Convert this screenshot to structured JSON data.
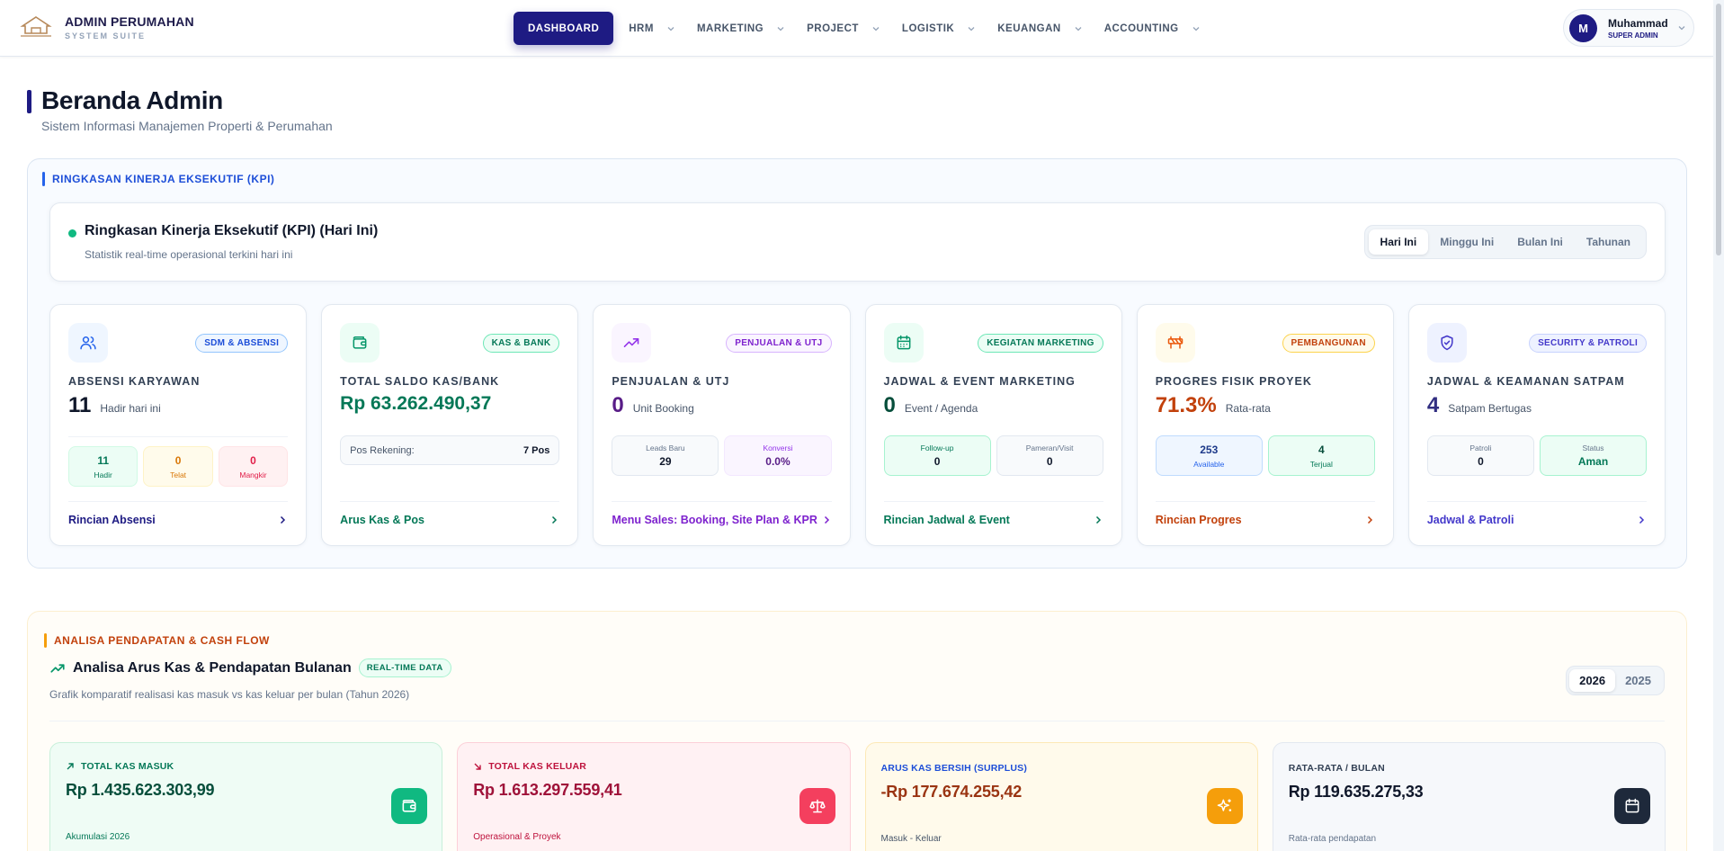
{
  "brand": {
    "title": "ADMIN PERUMAHAN",
    "subtitle": "SYSTEM SUITE"
  },
  "nav": {
    "dashboard": "DASHBOARD",
    "hrm": "HRM",
    "marketing": "MARKETING",
    "project": "PROJECT",
    "logistik": "LOGISTIK",
    "keuangan": "KEUANGAN",
    "accounting": "ACCOUNTING"
  },
  "user": {
    "initial": "M",
    "name": "Muhammad",
    "role": "SUPER ADMIN"
  },
  "page": {
    "title": "Beranda Admin",
    "subtitle": "Sistem Informasi Manajemen Properti & Perumahan"
  },
  "kpi": {
    "section_label": "RINGKASAN KINERJA EKSEKUTIF (KPI)",
    "header_title": "Ringkasan Kinerja Eksekutif (KPI) (Hari Ini)",
    "header_sub": "Statistik real-time operasional terkini hari ini",
    "periods": [
      "Hari Ini",
      "Minggu Ini",
      "Bulan Ini",
      "Tahunan"
    ],
    "active_period": "Hari Ini",
    "cards": {
      "absensi": {
        "badge": "SDM & ABSENSI",
        "title": "ABSENSI KARYAWAN",
        "value": "11",
        "unit": "Hadir hari ini",
        "hadir": "11",
        "hadir_label": "Hadir",
        "telat": "0",
        "telat_label": "Telat",
        "mangkir": "0",
        "mangkir_label": "Mangkir",
        "link": "Rincian Absensi"
      },
      "kas": {
        "badge": "KAS & BANK",
        "title": "TOTAL SALDO KAS/BANK",
        "value": "Rp 63.262.490,37",
        "pos_label": "Pos Rekening:",
        "pos_value": "7 Pos",
        "link": "Arus Kas & Pos"
      },
      "penjualan": {
        "badge": "PENJUALAN & UTJ",
        "title": "PENJUALAN & UTJ",
        "value": "0",
        "unit": "Unit Booking",
        "leads_label": "Leads Baru",
        "leads": "29",
        "konversi_label": "Konversi",
        "konversi": "0.0%",
        "link": "Menu Sales: Booking, Site Plan & KPR"
      },
      "marketing": {
        "badge": "KEGIATAN MARKETING",
        "title": "JADWAL & EVENT MARKETING",
        "value": "0",
        "unit": "Event / Agenda",
        "followup_label": "Follow-up",
        "followup": "0",
        "pameran_label": "Pameran/Visit",
        "pameran": "0",
        "link": "Rincian Jadwal & Event"
      },
      "progres": {
        "badge": "PEMBANGUNAN",
        "title": "PROGRES FISIK PROYEK",
        "value": "71.3%",
        "unit": "Rata-rata",
        "available": "253",
        "available_label": "Available",
        "terjual": "4",
        "terjual_label": "Terjual",
        "link": "Rincian Progres"
      },
      "security": {
        "badge": "SECURITY & PATROLI",
        "title": "JADWAL & KEAMANAN SATPAM",
        "value": "4",
        "unit": "Satpam Bertugas",
        "patroli_label": "Patroli",
        "patroli": "0",
        "status_label": "Status",
        "status": "Aman",
        "link": "Jadwal & Patroli"
      }
    }
  },
  "cashflow": {
    "section_label": "ANALISA PENDAPATAN & CASH FLOW",
    "title": "Analisa Arus Kas & Pendapatan Bulanan",
    "pill": "REAL-TIME DATA",
    "subtitle": "Grafik komparatif realisasi kas masuk vs kas keluar per bulan (Tahun 2026)",
    "years": [
      "2026",
      "2025"
    ],
    "active_year": "2026",
    "cards": {
      "masuk": {
        "label": "TOTAL KAS MASUK",
        "value": "Rp 1.435.623.303,99",
        "note": "Akumulasi 2026"
      },
      "keluar": {
        "label": "TOTAL KAS KELUAR",
        "value": "Rp 1.613.297.559,41",
        "note": "Operasional & Proyek"
      },
      "bersih": {
        "label": "ARUS KAS BERSIH (SURPLUS)",
        "value": "-Rp 177.674.255,42",
        "note": "Masuk - Keluar"
      },
      "rata": {
        "label": "RATA-RATA / BULAN",
        "value": "Rp 119.635.275,33",
        "note": "Rata-rata pendapatan"
      }
    }
  },
  "colors": {
    "primary": "#1e1b83",
    "blue": "#2563eb",
    "green": "#047857",
    "purple": "#7e22ce",
    "orange": "#c2410c",
    "indigo": "#4338ca",
    "red": "#e11d48",
    "amber": "#f59e0b"
  }
}
